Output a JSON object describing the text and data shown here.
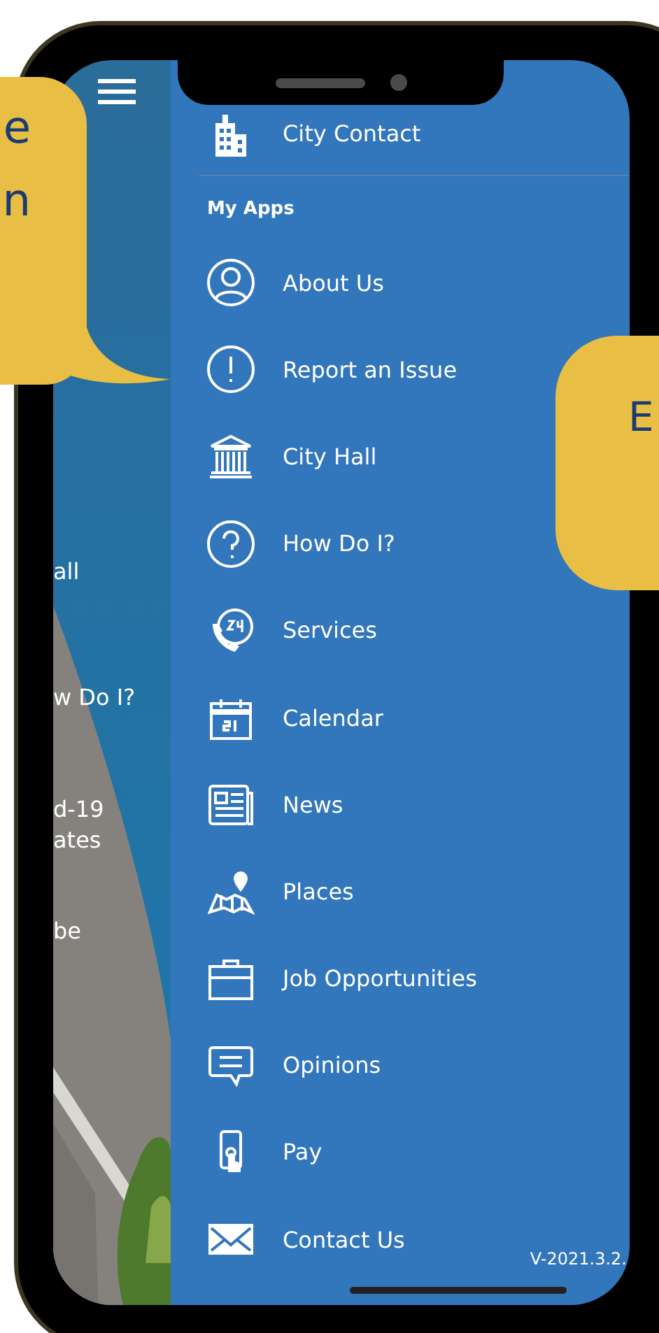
{
  "background_screen": {
    "labels": [
      {
        "lines": [
          "all"
        ]
      },
      {
        "lines": [
          "w Do I?"
        ]
      },
      {
        "lines": [
          "d-19",
          "ates"
        ]
      },
      {
        "lines": [
          "be"
        ]
      }
    ]
  },
  "drawer": {
    "top_item": {
      "label": "City Contact",
      "kind": "building"
    },
    "section_title": "My Apps",
    "items": [
      {
        "label": "About Us",
        "kind": "user"
      },
      {
        "label": "Report an Issue",
        "kind": "alert"
      },
      {
        "label": "City Hall",
        "kind": "hall"
      },
      {
        "label": "How Do I?",
        "kind": "question"
      },
      {
        "label": "Services",
        "kind": "phone24"
      },
      {
        "label": "Calendar",
        "kind": "calendar"
      },
      {
        "label": "News",
        "kind": "news"
      },
      {
        "label": "Places",
        "kind": "map"
      },
      {
        "label": "Job Opportunities",
        "kind": "briefcase"
      },
      {
        "label": "Opinions",
        "kind": "chat"
      },
      {
        "label": "Pay",
        "kind": "tap"
      },
      {
        "label": "Contact Us",
        "kind": "mail"
      }
    ],
    "version": "V-2021.3.2."
  },
  "left_callout": {
    "lines": [
      "e",
      "n"
    ]
  },
  "right_callout": {
    "lines": [
      "E"
    ]
  }
}
